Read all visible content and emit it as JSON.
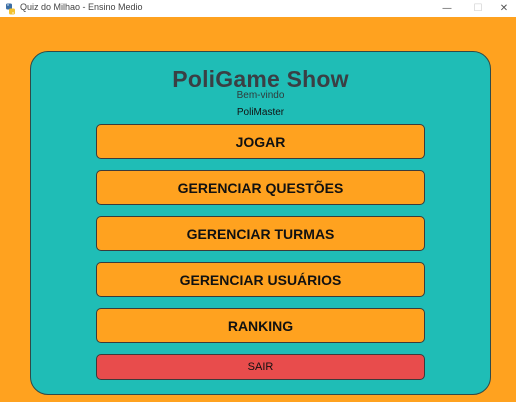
{
  "window": {
    "title": "Quiz do Milhao - Ensino Medio",
    "icon": "python-app-icon",
    "minimize_glyph": "—",
    "maximize_glyph": "☐",
    "close_glyph": "✕"
  },
  "header": {
    "title": "PoliGame Show",
    "welcome": "Bem-vindo",
    "username": "PoliMaster"
  },
  "menu": {
    "play": "JOGAR",
    "questions": "GERENCIAR QUESTÕES",
    "classes": "GERENCIAR TURMAS",
    "users": "GERENCIAR USUÁRIOS",
    "ranking": "RANKING",
    "exit": "SAIR"
  },
  "colors": {
    "background": "#ffa21f",
    "panel": "#1fbdb6",
    "button": "#ffa21f",
    "exit_button": "#e84c4c"
  }
}
